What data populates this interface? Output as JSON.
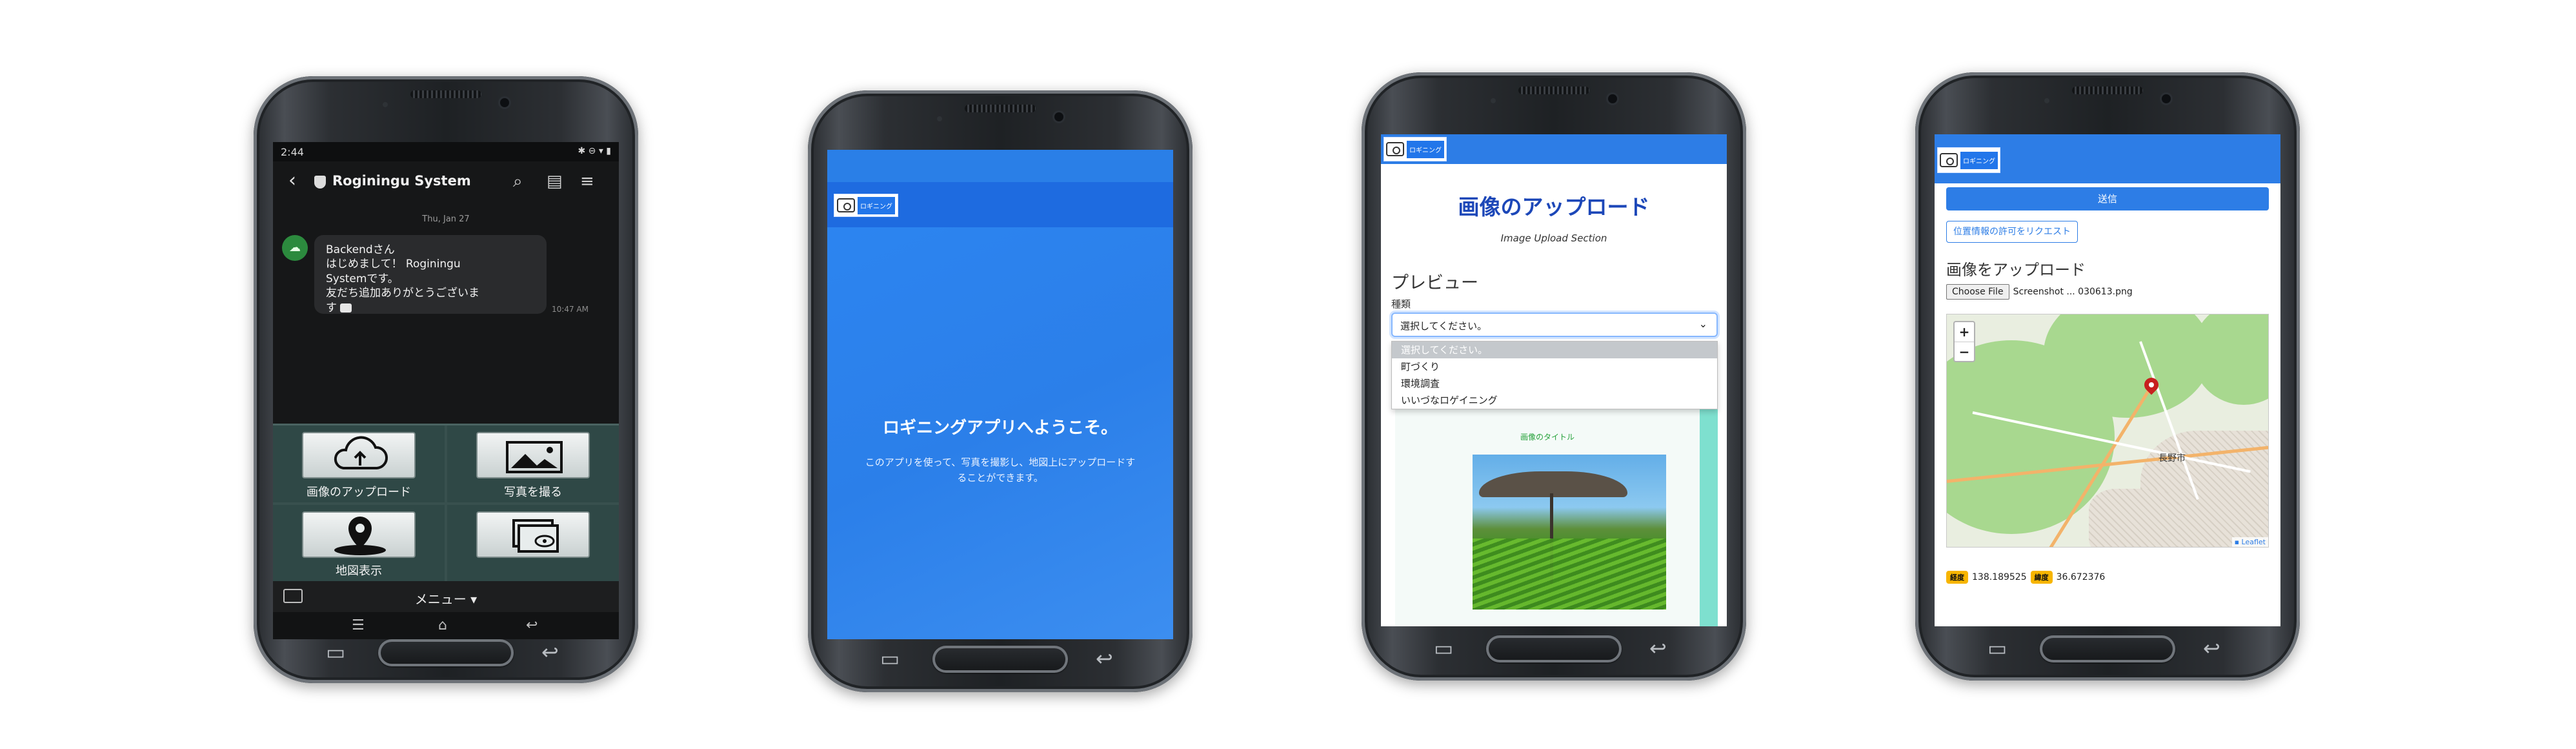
{
  "phone1": {
    "status_time": "2:44",
    "chat_title": "Roginingu System",
    "date_label": "Thu, Jan 27",
    "message_lines": [
      "Backendさん",
      "はじめまして！ Roginingu",
      "Systemです。",
      "友だち追加ありがとうございま",
      "す"
    ],
    "message_time": "10:47 AM",
    "rich_menu": [
      {
        "label": "画像のアップロード",
        "icon": "cloud-upload-icon"
      },
      {
        "label": "写真を撮る",
        "icon": "photo-icon"
      },
      {
        "label": "地図表示",
        "icon": "map-pin-icon"
      },
      {
        "label": "",
        "icon": "image-search-icon"
      }
    ],
    "menu_label": "メニュー ▾"
  },
  "phone2": {
    "logo_text": "ロギニング",
    "welcome_title": "ロギニングアプリへようこそ。",
    "intro_text": "このアプリを使って、写真を撮影し、地図上にアップロードすることができます。"
  },
  "phone3": {
    "logo_text": "ロギニング",
    "page_title": "画像のアップロード",
    "section_subtitle": "Image Upload Section",
    "preview_heading": "プレビュー",
    "type_label": "種類",
    "select_value": "選択してください。",
    "options": [
      "選択してください。",
      "町づくり",
      "環境調査",
      "いいづなロゲイニング"
    ],
    "image_title": "画像のタイトル"
  },
  "phone4": {
    "logo_text": "ロギニング",
    "send_label": "送信",
    "permission_label": "位置情報の許可をリクエスト",
    "upload_heading": "画像をアップロード",
    "file_button": "Choose File",
    "file_name": "Screenshot ... 030613.png",
    "zoom_in": "+",
    "zoom_out": "−",
    "city_label": "長野市",
    "attribution": "▪ Leaflet",
    "lng_badge": "経度",
    "lng_value": "138.189525",
    "lat_badge": "緯度",
    "lat_value": "36.672376"
  },
  "colors": {
    "brand_blue": "#2d7de6",
    "title_blue": "#1c47b8",
    "chat_bg": "#161718",
    "rich_menu_bg": "#38504e",
    "badge_yellow": "#f7b500",
    "map_pin": "#c7201f"
  }
}
